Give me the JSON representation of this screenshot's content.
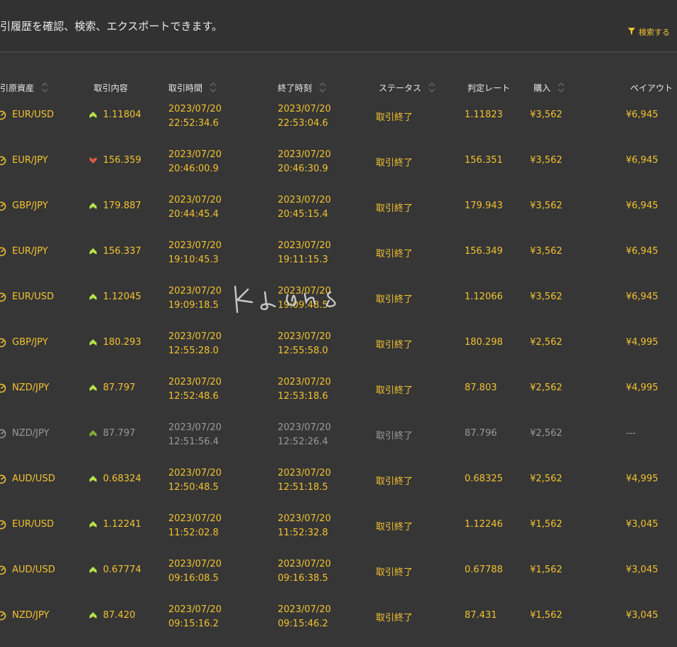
{
  "header": {
    "description": "引履歴を確認、検索、エクスポートできます。",
    "search_label": "検索する"
  },
  "columns": {
    "asset": "引原資産",
    "content": "取引内容",
    "time": "取引時間",
    "end": "終了時刻",
    "status": "ステータス",
    "rate": "判定レート",
    "buy": "購入",
    "payout": "ペイアウト"
  },
  "icons": {
    "gauge": "gauge-icon",
    "up": "up-arrow-icon",
    "down": "down-arrow-icon",
    "sort": "sort-icon",
    "filter": "filter-icon"
  },
  "colors": {
    "accent": "#f2c230",
    "up": "#b8e04a",
    "down": "#e0584a",
    "dim": "#9a9a9a",
    "background": "#363636"
  },
  "rows": [
    {
      "asset": "EUR/USD",
      "dir": "up",
      "entry": "1.11804",
      "start_date": "2023/07/20",
      "start_time": "22:52:34.6",
      "end_date": "2023/07/20",
      "end_time": "22:53:04.6",
      "status": "取引終了",
      "rate": "1.11823",
      "buy": "¥3,562",
      "payout": "¥6,945",
      "dim": false
    },
    {
      "asset": "EUR/JPY",
      "dir": "down",
      "entry": "156.359",
      "start_date": "2023/07/20",
      "start_time": "20:46:00.9",
      "end_date": "2023/07/20",
      "end_time": "20:46:30.9",
      "status": "取引終了",
      "rate": "156.351",
      "buy": "¥3,562",
      "payout": "¥6,945",
      "dim": false
    },
    {
      "asset": "GBP/JPY",
      "dir": "up",
      "entry": "179.887",
      "start_date": "2023/07/20",
      "start_time": "20:44:45.4",
      "end_date": "2023/07/20",
      "end_time": "20:45:15.4",
      "status": "取引終了",
      "rate": "179.943",
      "buy": "¥3,562",
      "payout": "¥6,945",
      "dim": false
    },
    {
      "asset": "EUR/JPY",
      "dir": "up",
      "entry": "156.337",
      "start_date": "2023/07/20",
      "start_time": "19:10:45.3",
      "end_date": "2023/07/20",
      "end_time": "19:11:15.3",
      "status": "取引終了",
      "rate": "156.349",
      "buy": "¥3,562",
      "payout": "¥6,945",
      "dim": false
    },
    {
      "asset": "EUR/USD",
      "dir": "up",
      "entry": "1.12045",
      "start_date": "2023/07/20",
      "start_time": "19:09:18.5",
      "end_date": "2023/07/20",
      "end_time": "19:09:48.5",
      "status": "取引終了",
      "rate": "1.12066",
      "buy": "¥3,562",
      "payout": "¥6,945",
      "dim": false
    },
    {
      "asset": "GBP/JPY",
      "dir": "up",
      "entry": "180.293",
      "start_date": "2023/07/20",
      "start_time": "12:55:28.0",
      "end_date": "2023/07/20",
      "end_time": "12:55:58.0",
      "status": "取引終了",
      "rate": "180.298",
      "buy": "¥2,562",
      "payout": "¥4,995",
      "dim": false
    },
    {
      "asset": "NZD/JPY",
      "dir": "up",
      "entry": "87.797",
      "start_date": "2023/07/20",
      "start_time": "12:52:48.6",
      "end_date": "2023/07/20",
      "end_time": "12:53:18.6",
      "status": "取引終了",
      "rate": "87.803",
      "buy": "¥2,562",
      "payout": "¥4,995",
      "dim": false
    },
    {
      "asset": "NZD/JPY",
      "dir": "up",
      "entry": "87.797",
      "start_date": "2023/07/20",
      "start_time": "12:51:56.4",
      "end_date": "2023/07/20",
      "end_time": "12:52:26.4",
      "status": "取引終了",
      "rate": "87.796",
      "buy": "¥2,562",
      "payout": "---",
      "dim": true
    },
    {
      "asset": "AUD/USD",
      "dir": "up",
      "entry": "0.68324",
      "start_date": "2023/07/20",
      "start_time": "12:50:48.5",
      "end_date": "2023/07/20",
      "end_time": "12:51:18.5",
      "status": "取引終了",
      "rate": "0.68325",
      "buy": "¥2,562",
      "payout": "¥4,995",
      "dim": false
    },
    {
      "asset": "EUR/USD",
      "dir": "up",
      "entry": "1.12241",
      "start_date": "2023/07/20",
      "start_time": "11:52:02.8",
      "end_date": "2023/07/20",
      "end_time": "11:52:32.8",
      "status": "取引終了",
      "rate": "1.12246",
      "buy": "¥1,562",
      "payout": "¥3,045",
      "dim": false
    },
    {
      "asset": "AUD/USD",
      "dir": "up",
      "entry": "0.67774",
      "start_date": "2023/07/20",
      "start_time": "09:16:08.5",
      "end_date": "2023/07/20",
      "end_time": "09:16:38.5",
      "status": "取引終了",
      "rate": "0.67788",
      "buy": "¥1,562",
      "payout": "¥3,045",
      "dim": false
    },
    {
      "asset": "NZD/JPY",
      "dir": "up",
      "entry": "87.420",
      "start_date": "2023/07/20",
      "start_time": "09:15:16.2",
      "end_date": "2023/07/20",
      "end_time": "09:15:46.2",
      "status": "取引終了",
      "rate": "87.431",
      "buy": "¥1,562",
      "payout": "¥3,045",
      "dim": false
    }
  ]
}
